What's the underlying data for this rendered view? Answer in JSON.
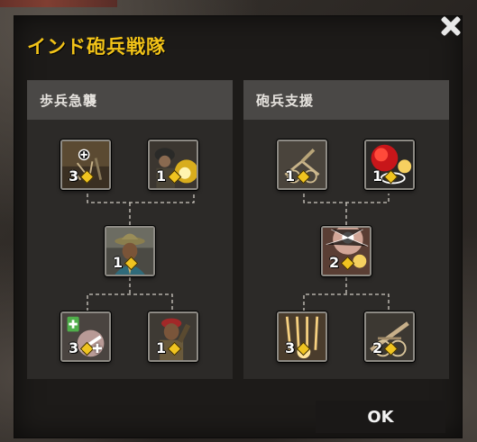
{
  "dialog": {
    "title": "インド砲兵戦隊",
    "ok_label": "OK"
  },
  "trees": [
    {
      "name": "歩兵急襲",
      "abilities": [
        {
          "id": "inf-1",
          "rank": "3",
          "has_plus": false,
          "icon": "squad-ambush-icon"
        },
        {
          "id": "inf-2",
          "rank": "1",
          "has_plus": false,
          "icon": "grenade-soldier-icon"
        },
        {
          "id": "inf-3",
          "rank": "1",
          "has_plus": false,
          "icon": "officer-portrait-icon"
        },
        {
          "id": "inf-4",
          "rank": "3",
          "has_plus": true,
          "icon": "medic-upgrade-icon"
        },
        {
          "id": "inf-5",
          "rank": "1",
          "has_plus": false,
          "icon": "commando-icon"
        }
      ]
    },
    {
      "name": "砲兵支援",
      "abilities": [
        {
          "id": "art-1",
          "rank": "1",
          "has_plus": false,
          "icon": "artillery-crew-icon"
        },
        {
          "id": "art-2",
          "rank": "1",
          "has_plus": false,
          "icon": "target-strike-icon"
        },
        {
          "id": "art-3",
          "rank": "2",
          "has_plus": false,
          "icon": "flare-barrage-icon"
        },
        {
          "id": "art-4",
          "rank": "3",
          "has_plus": false,
          "icon": "shell-salvo-icon"
        },
        {
          "id": "art-5",
          "rank": "2",
          "has_plus": false,
          "icon": "howitzer-icon"
        }
      ]
    }
  ],
  "colors": {
    "title": "#f2c318",
    "rank_diamond": "#f0c420"
  }
}
